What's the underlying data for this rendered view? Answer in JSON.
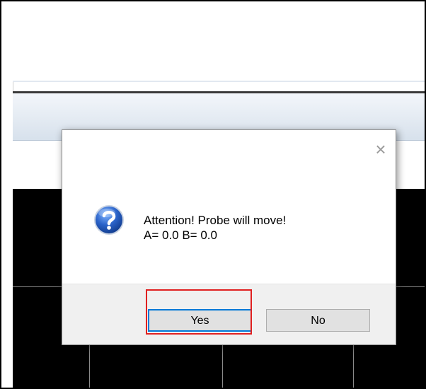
{
  "dialog": {
    "message_line1": "Attention! Probe will move!",
    "message_line2": "A= 0.0 B= 0.0",
    "yes_label": "Yes",
    "no_label": "No",
    "close_symbol": "×",
    "icon": "question-icon"
  },
  "colors": {
    "highlight": "#e02020",
    "background_dark": "#000000",
    "button_face": "#e1e1e1",
    "focus_border": "#0078d7"
  }
}
